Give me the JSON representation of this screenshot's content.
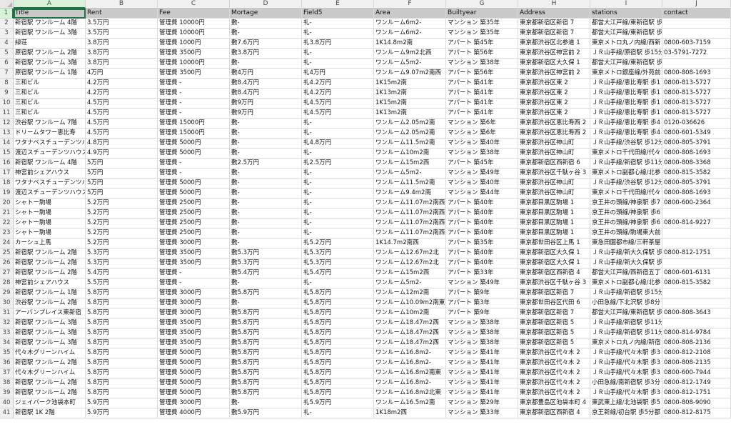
{
  "columns": [
    "A",
    "B",
    "C",
    "D",
    "E",
    "F",
    "G",
    "H",
    "I",
    "J"
  ],
  "selected_column": "A",
  "selected_row": "1",
  "headers": [
    "Title",
    "Rent",
    "Fee",
    "Mortage",
    "Field5",
    "Area",
    "Builtyear",
    "Address",
    "stations",
    "contact"
  ],
  "rows": [
    [
      "新宿駅 ワンルーム 4階",
      "3.5万円",
      "管理費 10000円",
      "敷-",
      "礼-",
      "ワンルーム6m2-",
      "マンション 築35年",
      "東京都新宿区新宿 7",
      "都営大江戸線/東新宿駅 歩",
      ""
    ],
    [
      "新宿駅 ワンルーム 3階",
      "3.5万円",
      "管理費 10000円",
      "敷-",
      "礼-",
      "ワンルーム6m2-",
      "マンション 築35年",
      "東京都新宿区新宿 7",
      "都営大江戸線/東新宿駅 歩",
      ""
    ],
    [
      "緑荘",
      "3.8万円",
      "管理費 1000円",
      "敷7.6万円",
      "礼3.8万円",
      "1K14.8m2南",
      "アパート 築45年",
      "東京都渋谷区北参道 1",
      "東京メトロ丸ノ内線/西新",
      "0800-603-7159"
    ],
    [
      "原宿駅 ワンルーム 2階",
      "3.8万円",
      "管理費 3500円",
      "敷3.8万円",
      "礼-",
      "ワンルーム9m2北西",
      "アパート 築56年",
      "東京都渋谷区神宮前 2",
      "ＪＲ山手線/原宿駅 歩15分",
      "03-5791-7272"
    ],
    [
      "新宿駅 ワンルーム 3階",
      "3.8万円",
      "管理費 10000円",
      "敷-",
      "礼-",
      "ワンルーム5m2-",
      "マンション 築38年",
      "東京都新宿区大久保 1",
      "都営大江戸線/東新宿駅 歩",
      ""
    ],
    [
      "原宿駅 ワンルーム 1階",
      "4万円",
      "管理費 3500円",
      "敷4万円",
      "礼4万円",
      "ワンルーム9.07m2南西",
      "アパート 築56年",
      "東京都渋谷区神宮前 2",
      "東京メトロ銀座線/外苑前",
      "0800-808-1693"
    ],
    [
      "三和ビル",
      "4.2万円",
      "管理費 -",
      "敷8.4万円",
      "礼4.2万円",
      "1K15m2南",
      "アパート 築41年",
      "東京都渋谷区東 2",
      "ＪＲ山手線/恵比寿駅 歩1",
      "0800-813-5727"
    ],
    [
      "三和ビル",
      "4.2万円",
      "管理費 -",
      "敷8.4万円",
      "礼4.2万円",
      "1K13m2南",
      "アパート 築41年",
      "東京都渋谷区東 2",
      "ＪＲ山手線/恵比寿駅 歩1",
      "0800-813-5727"
    ],
    [
      "三和ビル",
      "4.5万円",
      "管理費 -",
      "敷9万円",
      "礼4.5万円",
      "1K15m2南",
      "アパート 築41年",
      "東京都渋谷区東 2",
      "ＪＲ山手線/恵比寿駅 歩1",
      "0800-813-5727"
    ],
    [
      "三和ビル",
      "4.5万円",
      "管理費 -",
      "敷9万円",
      "礼4.5万円",
      "1K13m2南",
      "アパート 築41年",
      "東京都渋谷区東 2",
      "ＪＲ山手線/恵比寿駅 歩1",
      "0800-813-5727"
    ],
    [
      "渋谷駅 ワンルーム 7階",
      "4.5万円",
      "管理費 15000円",
      "敷-",
      "礼-",
      "ワンルーム2.05m2南",
      "マンション 築6年",
      "東京都渋谷区恵比寿西 2",
      "ＪＲ山手線/恵比寿駅 歩4",
      "0120-036626"
    ],
    [
      "ドリームタワー恵比寿",
      "4.5万円",
      "管理費 15000円",
      "敷-",
      "礼-",
      "ワンルーム2.05m2南",
      "マンション 築6年",
      "東京都渋谷区恵比寿西 2",
      "ＪＲ山手線/恵比寿駅 歩4",
      "0800-601-5349"
    ],
    [
      "ワタナベスチューデンツハ",
      "4.8万円",
      "管理費 5000円",
      "敷-",
      "礼4.8万円",
      "ワンルーム11.5m2南",
      "マンション 築40年",
      "東京都渋谷区神山町",
      "ＪＲ山手線/渋谷駅 歩12分",
      "0800-805-3791"
    ],
    [
      "渡辺スチューデンツハウス",
      "4.9万円",
      "管理費 5000円",
      "敷-",
      "礼-",
      "ワンルーム10m2南",
      "マンション 築38年",
      "東京都渋谷区神山町",
      "東京メトロ千代田線/代々",
      "0800-808-1693"
    ],
    [
      "新宿駅 ワンルーム 4階",
      "5万円",
      "管理費 -",
      "敷2.5万円",
      "礼2.5万円",
      "ワンルーム15m2西",
      "アパート 築45年",
      "東京都新宿区西新宿 6",
      "ＪＲ山手線/新宿駅 歩11分",
      "0800-808-3368"
    ],
    [
      "神宮前シェアハウス",
      "5万円",
      "管理費 -",
      "敷-",
      "礼-",
      "ワンルーム5m2-",
      "マンション 築49年",
      "東京都渋谷区千駄ヶ谷 3",
      "東京メトロ副都心線/北参",
      "0800-815-3582"
    ],
    [
      "ワタナベスチューデンツハ",
      "5万円",
      "管理費 5000円",
      "敷-",
      "礼-",
      "ワンルーム11.5m2南",
      "マンション 築40年",
      "東京都渋谷区神山町",
      "ＪＲ山手線/渋谷駅 歩12分",
      "0800-805-3791"
    ],
    [
      "渡辺スチューデンツハウス",
      "5万円",
      "管理費 5000円",
      "敷-",
      "礼-",
      "ワンルーム9.4m2南",
      "マンション 築44年",
      "東京都渋谷区神山町",
      "東京メトロ千代田線/代々",
      "0800-808-1693"
    ],
    [
      "シャトー駒場",
      "5.2万円",
      "管理費 2500円",
      "敷-",
      "礼-",
      "ワンルーム11.07m2南西",
      "アパート 築40年",
      "東京都目黒区駒場 1",
      "京王井の頭線/神泉駅 歩7",
      "0800-600-2364"
    ],
    [
      "シャトー駒場",
      "5.2万円",
      "管理費 2500円",
      "敷-",
      "礼-",
      "ワンルーム11.07m2南西",
      "アパート 築40年",
      "東京都目黒区駒場 1",
      "京王井の頭線/神泉駅 歩6",
      ""
    ],
    [
      "シャトー駒場",
      "5.2万円",
      "管理費 2500円",
      "敷-",
      "礼-",
      "ワンルーム11.07m2南西",
      "アパート 築40年",
      "東京都目黒区駒場 1",
      "京王井の頭線/神泉駅 歩6",
      "0800-814-9227"
    ],
    [
      "シャトー駒場",
      "5.2万円",
      "管理費 2500円",
      "敷-",
      "礼-",
      "ワンルーム11.07m2南西",
      "アパート 築40年",
      "東京都目黒区駒場 1",
      "京王井の頭線/駒場東大前",
      ""
    ],
    [
      "カーシュ上馬",
      "5.2万円",
      "管理費 3000円",
      "敷-",
      "礼5.2万円",
      "1K14.7m2南西",
      "アパート 築35年",
      "東京都世田谷区上馬 1",
      "東急田園都市線/三軒茶屋",
      ""
    ],
    [
      "新宿駅 ワンルーム 2階",
      "5.3万円",
      "管理費 3500円",
      "敷5.3万円",
      "礼5.3万円",
      "ワンルーム12.67m2北",
      "アパート 築40年",
      "東京都新宿区大久保 1",
      "ＪＲ山手線/新大久保駅 歩",
      "0800-812-1751"
    ],
    [
      "新宿駅 ワンルーム 2階",
      "5.3万円",
      "管理費 3500円",
      "敷5.3万円",
      "礼5.3万円",
      "ワンルーム12.67m2北",
      "アパート 築40年",
      "東京都新宿区大久保 1",
      "ＪＲ山手線/新大久保駅 歩",
      ""
    ],
    [
      "新宿駅 ワンルーム 2階",
      "5.4万円",
      "管理費 -",
      "敷5.4万円",
      "礼5.4万円",
      "ワンルーム15m2西",
      "アパート 築33年",
      "東京都新宿区西新宿 4",
      "都営大江戸線/西新宿五丁",
      "0800-601-6131"
    ],
    [
      "神宮前シェアハウス",
      "5.5万円",
      "管理費 -",
      "敷-",
      "礼-",
      "ワンルーム5m2-",
      "マンション 築49年",
      "東京都渋谷区千駄ヶ谷 3",
      "東京メトロ副都心線/北参",
      "0800-815-3582"
    ],
    [
      "新宿駅 ワンルーム 1階",
      "5.8万円",
      "管理費 3000円",
      "敷5.8万円",
      "礼5.8万円",
      "ワンルーム12m2南",
      "アパート 築9年",
      "東京都新宿区新宿 7",
      "ＪＲ山手線/新宿駅 歩15分",
      ""
    ],
    [
      "渋谷駅 ワンルーム 2階",
      "5.8万円",
      "管理費 3000円",
      "敷-",
      "礼5.8万円",
      "ワンルーム10.09m2南東",
      "アパート 築3年",
      "東京都世田谷区代田 6",
      "小田急線/下北沢駅 歩8分",
      ""
    ],
    [
      "アーバンプレイス東新宿",
      "5.8万円",
      "管理費 3000円",
      "敷5.8万円",
      "礼5.8万円",
      "ワンルーム10m2南",
      "アパート 築9年",
      "東京都新宿区新宿 7",
      "都営大江戸線/東新宿駅 歩",
      "0800-808-3643"
    ],
    [
      "新宿駅 ワンルーム 3階",
      "5.8万円",
      "管理費 3500円",
      "敷5.8万円",
      "礼5.8万円",
      "ワンルーム18.47m2西",
      "マンション 築38年",
      "東京都新宿区新宿 5",
      "ＪＲ山手線/新宿駅 歩11分",
      ""
    ],
    [
      "新宿駅 ワンルーム 3階",
      "5.8万円",
      "管理費 3500円",
      "敷5.8万円",
      "礼5.8万円",
      "ワンルーム18.47m2西",
      "マンション 築38年",
      "東京都新宿区新宿 5",
      "ＪＲ山手線/新宿駅 歩11分",
      "0800-814-9784"
    ],
    [
      "新宿駅 ワンルーム 3階",
      "5.8万円",
      "管理費 3500円",
      "敷5.8万円",
      "礼5.8万円",
      "ワンルーム18.47m2西",
      "マンション 築38年",
      "東京都新宿区新宿 5",
      "東京メトロ丸ノ内線/新宿",
      "0800-808-2136"
    ],
    [
      "代々木グリーンハイム",
      "5.8万円",
      "管理費 5000円",
      "敷5.8万円",
      "礼5.8万円",
      "ワンルーム16.8m2-",
      "マンション 築41年",
      "東京都渋谷区代々木 2",
      "ＪＲ山手線/代々木駅 歩3",
      "0800-812-2108"
    ],
    [
      "新宿駅 ワンルーム 2階",
      "5.8万円",
      "管理費 5000円",
      "敷5.8万円",
      "礼5.8万円",
      "ワンルーム16.8m2-",
      "マンション 築41年",
      "東京都渋谷区代々木 2",
      "ＪＲ山手線/代々木駅 歩3",
      "0800-808-2135"
    ],
    [
      "代々木グリーンハイム",
      "5.8万円",
      "管理費 5000円",
      "敷5.8万円",
      "礼5.8万円",
      "ワンルーム16.8m2南東",
      "マンション 築41年",
      "東京都渋谷区代々木 2",
      "ＪＲ山手線/代々木駅 歩3",
      "0800-600-7944"
    ],
    [
      "新宿駅 ワンルーム 2階",
      "5.8万円",
      "管理費 5000円",
      "敷5.8万円",
      "礼5.8万円",
      "ワンルーム16.8m2-",
      "マンション 築41年",
      "東京都渋谷区代々木 2",
      "小田急線/南新宿駅 歩3分",
      "0800-812-1749"
    ],
    [
      "新宿駅 ワンルーム 2階",
      "5.8万円",
      "管理費 5000円",
      "敷5.8万円",
      "礼5.8万円",
      "ワンルーム16.8m2北東",
      "マンション 築41年",
      "東京都渋谷区代々木 2",
      "ＪＲ山手線/代々木駅 歩3",
      "0800-812-1751"
    ],
    [
      "ジェイパーク池袋本町",
      "5.9万円",
      "管理費 3000円",
      "敷-",
      "礼5.9万円",
      "ワンルーム16.5m2南",
      "マンション 築29年",
      "東京都豊島区池袋本町 4",
      "東武東上線/北池袋駅 歩5",
      "0800-808-9090"
    ],
    [
      "新宿駅 1K 2階",
      "5.9万円",
      "管理費 4000円",
      "敷5.9万円",
      "礼-",
      "1K18m2西",
      "マンション 築33年",
      "東京都新宿区西新宿 4",
      "京王新線/初台駅 歩5分都",
      "0800-812-8175"
    ]
  ]
}
